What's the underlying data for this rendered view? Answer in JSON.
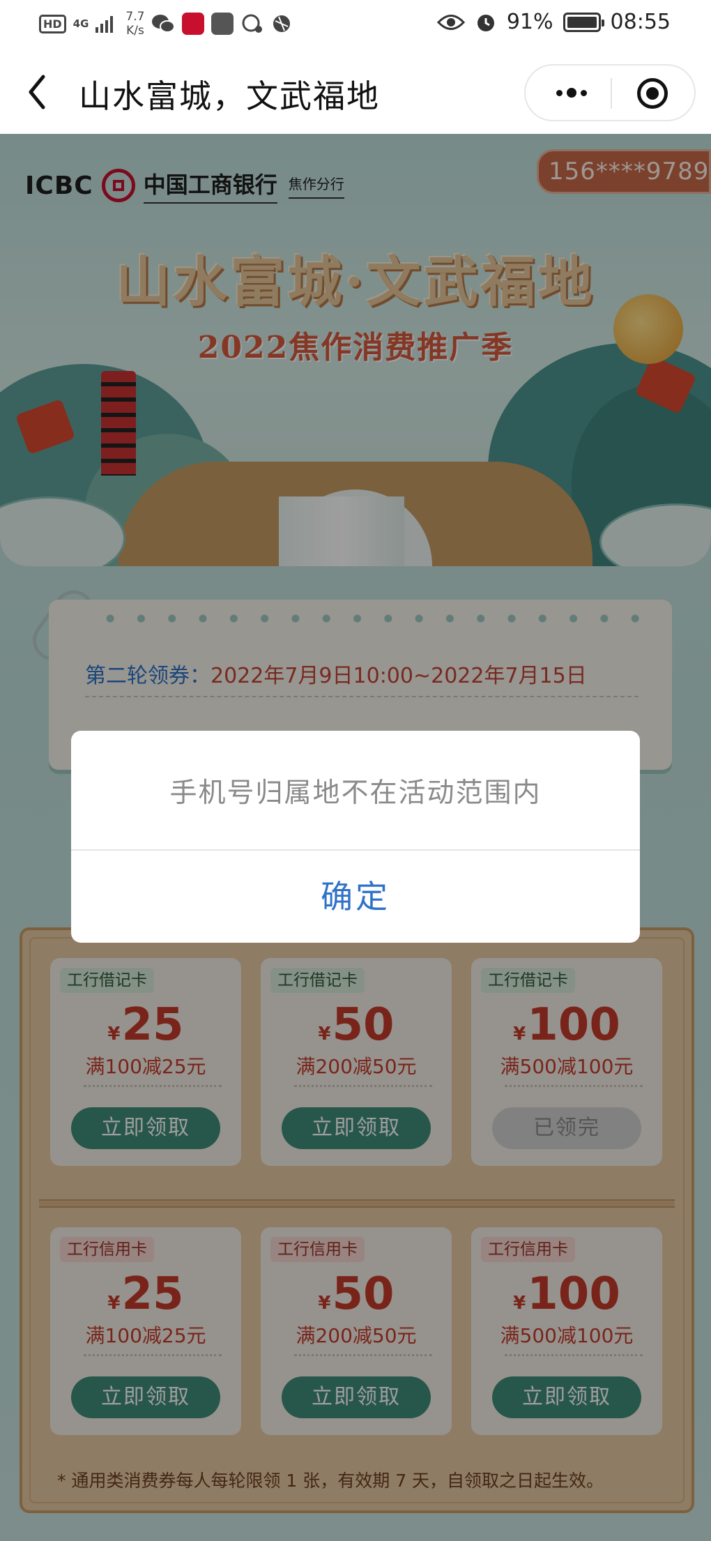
{
  "status_bar": {
    "hd": "HD",
    "network": "4G",
    "speed_top": "7.7",
    "speed_bottom": "K/s",
    "battery_pct": "91%",
    "time": "08:55",
    "icons": [
      "wechat-icon",
      "icbc-app-icon",
      "app-icon",
      "chat-icon",
      "browser-icon",
      "eye-icon",
      "alarm-icon",
      "battery-icon"
    ]
  },
  "nav": {
    "title": "山水富城，文武福地",
    "back_icon": "chevron-left-icon",
    "more_icon": "more-dots-icon",
    "close_icon": "target-close-icon"
  },
  "banner": {
    "logo_en": "ICBC",
    "logo_cn": "中国工商银行",
    "logo_branch": "焦作分行",
    "phone": "156****9789",
    "title": "山水富城·文武福地",
    "subtitle": "2022焦作消费推广季"
  },
  "notice": {
    "label": "第二轮领券：",
    "period": "2022年7月9日10:00~2022年7月15日"
  },
  "coupons": [
    {
      "tag": "工行借记卡",
      "currency": "¥",
      "amount": "25",
      "condition": "满100减25元",
      "button": "立即领取",
      "state": "available"
    },
    {
      "tag": "工行借记卡",
      "currency": "¥",
      "amount": "50",
      "condition": "满200减50元",
      "button": "立即领取",
      "state": "available"
    },
    {
      "tag": "工行借记卡",
      "currency": "¥",
      "amount": "100",
      "condition": "满500减100元",
      "button": "已领完",
      "state": "sold_out"
    },
    {
      "tag": "工行信用卡",
      "currency": "¥",
      "amount": "25",
      "condition": "满100减25元",
      "button": "立即领取",
      "state": "available"
    },
    {
      "tag": "工行信用卡",
      "currency": "¥",
      "amount": "50",
      "condition": "满200减50元",
      "button": "立即领取",
      "state": "available"
    },
    {
      "tag": "工行信用卡",
      "currency": "¥",
      "amount": "100",
      "condition": "满500减100元",
      "button": "立即领取",
      "state": "available"
    }
  ],
  "footnote": "* 通用类消费券每人每轮限领 1 张，有效期 7 天，自领取之日起生效。",
  "modal": {
    "message": "手机号归属地不在活动范围内",
    "confirm": "确定"
  },
  "colors": {
    "accent_blue": "#2f72c9",
    "coupon_red": "#c33a2a",
    "button_green": "#3f8d78",
    "phone_badge": "#c96a4a"
  }
}
